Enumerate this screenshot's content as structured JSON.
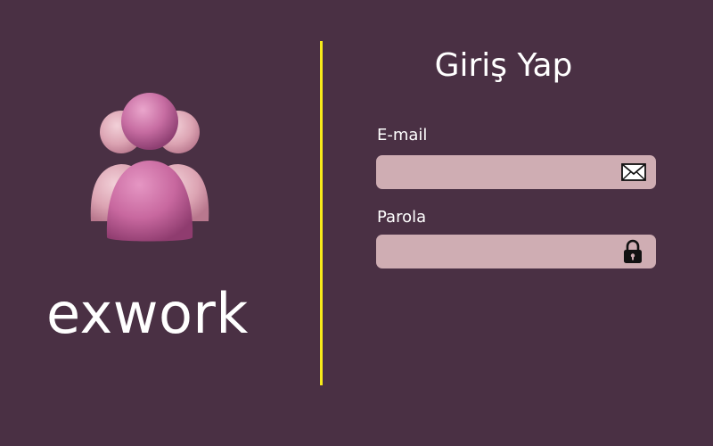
{
  "brand": {
    "name": "exwork",
    "logo_icon": "users-group-icon"
  },
  "login": {
    "title": "Giriş Yap",
    "email": {
      "label": "E-mail",
      "value": "",
      "placeholder": "",
      "icon": "mail-icon"
    },
    "password": {
      "label": "Parola",
      "value": "",
      "placeholder": "",
      "icon": "lock-icon"
    }
  },
  "colors": {
    "background": "#4a3044",
    "divider": "#f7ea1a",
    "field_background": "#cfadb3",
    "text": "#ffffff",
    "icon": "#111111"
  }
}
